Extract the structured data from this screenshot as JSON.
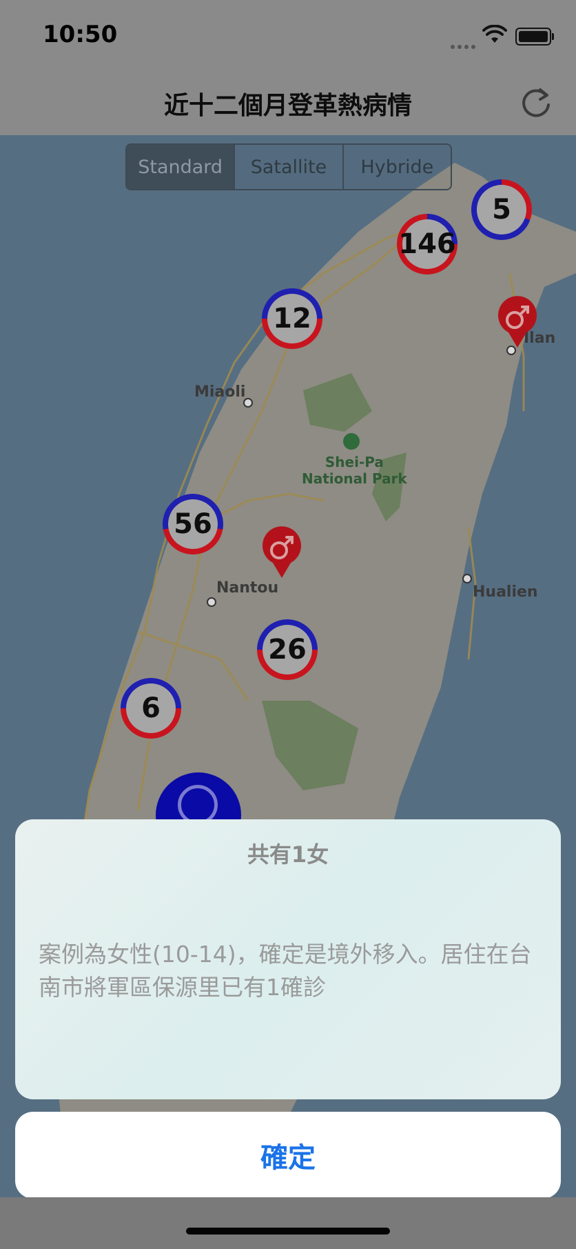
{
  "status_bar": {
    "time": "10:50"
  },
  "nav": {
    "title": "近十二個月登革熱病情"
  },
  "map_type": {
    "options": [
      "Standard",
      "Satallite",
      "Hybride"
    ],
    "selected": "Standard"
  },
  "clusters": [
    {
      "count": "5"
    },
    {
      "count": "146"
    },
    {
      "count": "12"
    },
    {
      "count": "56"
    },
    {
      "count": "26"
    },
    {
      "count": "6"
    }
  ],
  "places": {
    "miaoli": "Miaoli",
    "nantou": "Nantou",
    "hualien": "Hualien",
    "yilan": "Ilan",
    "park_line1": "Shei-Pa",
    "park_line2": "National Park"
  },
  "alert": {
    "title": "共有1女",
    "message": "案例為女性(10-14)，確定是境外移入。居住在台南市將軍區保源里已有1確診",
    "ok_label": "確定"
  },
  "colors": {
    "male_pin": "#b3121a",
    "cluster_blue": "#1f1fb0",
    "cluster_red": "#c8141e",
    "accent": "#1a73e8"
  }
}
